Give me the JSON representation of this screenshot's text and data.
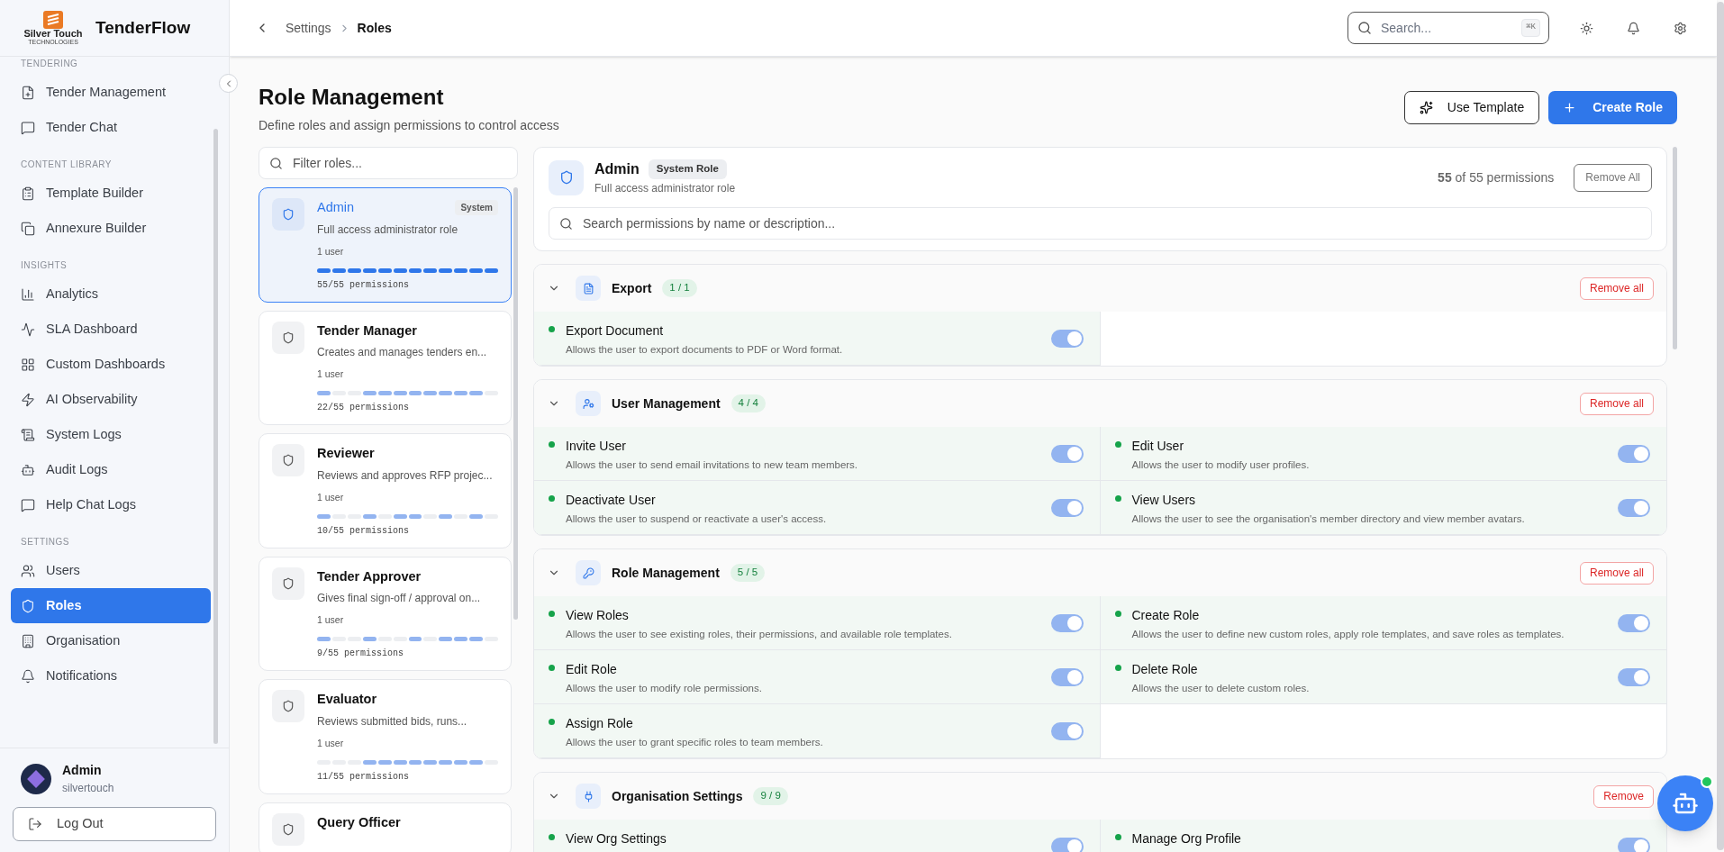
{
  "logo": {
    "name": "Silver Touch",
    "tagline": "TECHNOLOGIES"
  },
  "app_name": "TenderFlow",
  "sidebar": {
    "sections": [
      {
        "label": "TENDERING",
        "items": [
          {
            "label": "Tender Management",
            "selected": false
          },
          {
            "label": "Tender Chat",
            "selected": false
          }
        ]
      },
      {
        "label": "CONTENT LIBRARY",
        "items": [
          {
            "label": "Template Builder",
            "selected": false
          },
          {
            "label": "Annexure Builder",
            "selected": false
          }
        ]
      },
      {
        "label": "INSIGHTS",
        "items": [
          {
            "label": "Analytics",
            "selected": false
          },
          {
            "label": "SLA Dashboard",
            "selected": false
          },
          {
            "label": "Custom Dashboards",
            "selected": false
          },
          {
            "label": "AI Observability",
            "selected": false
          },
          {
            "label": "System Logs",
            "selected": false
          },
          {
            "label": "Audit Logs",
            "selected": false
          },
          {
            "label": "Help Chat Logs",
            "selected": false
          }
        ]
      },
      {
        "label": "SETTINGS",
        "items": [
          {
            "label": "Users",
            "selected": false
          },
          {
            "label": "Roles",
            "selected": true
          },
          {
            "label": "Organisation",
            "selected": false
          },
          {
            "label": "Notifications",
            "selected": false
          }
        ]
      }
    ],
    "user": {
      "name": "Admin",
      "org": "silvertouch"
    },
    "logout": "Log Out"
  },
  "breadcrumbs": [
    "Settings",
    "Roles"
  ],
  "search": {
    "placeholder": "Search...",
    "shortcut": "⌘K"
  },
  "page": {
    "title": "Role Management",
    "subtitle": "Define roles and assign permissions to control access",
    "buttons": [
      "Use Template",
      "Create Role"
    ]
  },
  "role_filter": {
    "placeholder": "Filter roles..."
  },
  "roles": [
    {
      "name": "Admin",
      "badge": "System",
      "description": "Full access administrator role",
      "users": "1 user",
      "permissions": "55/55 permissions",
      "selected": true,
      "segments": [
        true,
        true,
        true,
        true,
        true,
        true,
        true,
        true,
        true,
        true,
        true,
        true
      ]
    },
    {
      "name": "Tender Manager",
      "description": "Creates and manages tenders en...",
      "users": "1 user",
      "permissions": "22/55 permissions",
      "selected": false,
      "segments": [
        true,
        false,
        false,
        true,
        true,
        true,
        true,
        true,
        true,
        true,
        true,
        false
      ]
    },
    {
      "name": "Reviewer",
      "description": "Reviews and approves RFP projec...",
      "users": "1 user",
      "permissions": "10/55 permissions",
      "selected": false,
      "segments": [
        true,
        false,
        false,
        true,
        false,
        true,
        true,
        false,
        true,
        false,
        true,
        false
      ]
    },
    {
      "name": "Tender Approver",
      "description": "Gives final sign-off / approval on...",
      "users": "1 user",
      "permissions": "9/55 permissions",
      "selected": false,
      "segments": [
        true,
        false,
        false,
        true,
        false,
        false,
        true,
        false,
        true,
        true,
        true,
        false
      ]
    },
    {
      "name": "Evaluator",
      "description": "Reviews submitted bids, runs...",
      "users": "1 user",
      "permissions": "11/55 permissions",
      "selected": false,
      "segments": [
        false,
        false,
        false,
        true,
        true,
        true,
        true,
        true,
        true,
        true,
        true,
        false
      ]
    },
    {
      "name": "Query Officer",
      "selected": false
    }
  ],
  "role_detail": {
    "name": "Admin",
    "badge": "System Role",
    "description": "Full access administrator role",
    "count": "**55** of 55 permissions",
    "remove_all": "Remove All",
    "search_placeholder": "Search permissions by name or description..."
  },
  "categories": [
    {
      "name": "Export",
      "count": "1 / 1",
      "expanded": true,
      "remove": "Remove all",
      "permissions": [
        {
          "name": "Export Document",
          "description": "Allows the user to export documents to PDF or Word format.",
          "on": true
        }
      ]
    },
    {
      "name": "User Management",
      "count": "4 / 4",
      "expanded": true,
      "remove": "Remove all",
      "permissions": [
        {
          "name": "Invite User",
          "description": "Allows the user to send email invitations to new team members.",
          "on": true
        },
        {
          "name": "Edit User",
          "description": "Allows the user to modify user profiles.",
          "on": true
        },
        {
          "name": "Deactivate User",
          "description": "Allows the user to suspend or reactivate a user's access.",
          "on": true
        },
        {
          "name": "View Users",
          "description": "Allows the user to see the organisation's member directory and view member avatars.",
          "on": true
        }
      ]
    },
    {
      "name": "Role Management",
      "count": "5 / 5",
      "expanded": true,
      "remove": "Remove all",
      "permissions": [
        {
          "name": "View Roles",
          "description": "Allows the user to see existing roles, their permissions, and available role templates.",
          "on": true
        },
        {
          "name": "Create Role",
          "description": "Allows the user to define new custom roles, apply role templates, and save roles as templates.",
          "on": true
        },
        {
          "name": "Edit Role",
          "description": "Allows the user to modify role permissions.",
          "on": true
        },
        {
          "name": "Delete Role",
          "description": "Allows the user to delete custom roles.",
          "on": true
        },
        {
          "name": "Assign Role",
          "description": "Allows the user to grant specific roles to team members.",
          "on": true
        }
      ]
    },
    {
      "name": "Organisation Settings",
      "count": "9 / 9",
      "expanded": true,
      "remove": "Remove",
      "permissions": [
        {
          "name": "View Org Settings",
          "on": true
        },
        {
          "name": "Manage Org Profile",
          "on": true
        }
      ]
    }
  ]
}
